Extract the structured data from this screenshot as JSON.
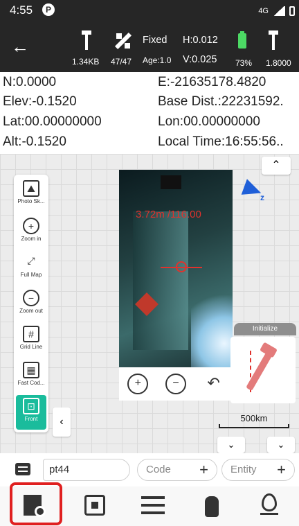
{
  "status_bar": {
    "time": "4:55",
    "carrier_icon_letter": "P",
    "network": "4G"
  },
  "toolbar": {
    "data_size": "1.34KB",
    "satellites": "47/47",
    "solution": "Fixed",
    "age": "Age:1.0",
    "h_precision": "H:0.012",
    "v_precision": "V:0.025",
    "battery_pct": "73%",
    "antenna_height": "1.8000"
  },
  "info": {
    "north": "N:0.0000",
    "east": "E:-21635178.4820",
    "elev": "Elev:-0.1520",
    "base_dist": "Base Dist.:22231592.",
    "lat": "Lat:00.00000000",
    "lon": "Lon:00.00000000",
    "alt": "Alt:-0.1520",
    "local_time": "Local Time:16:55:56.."
  },
  "tools": [
    {
      "label": "Photo Sk...",
      "icon": "photo-sketch-icon",
      "glyph": "⛰"
    },
    {
      "label": "Zoom in",
      "icon": "zoom-in-icon",
      "glyph": "+"
    },
    {
      "label": "Full Map",
      "icon": "full-map-icon",
      "glyph": "⤢"
    },
    {
      "label": "Zoom out",
      "icon": "zoom-out-icon",
      "glyph": "−"
    },
    {
      "label": "Grid Line",
      "icon": "grid-line-icon",
      "glyph": "#"
    },
    {
      "label": "Fast Cod...",
      "icon": "fast-code-icon",
      "glyph": "▦"
    },
    {
      "label": "Front",
      "icon": "front-icon",
      "glyph": "⊡"
    }
  ],
  "camera": {
    "measurement": "3.72m /116.00"
  },
  "initialize": {
    "label": "Initialize"
  },
  "scale": {
    "label": "500km"
  },
  "input_row": {
    "point_name": "pt44",
    "code_placeholder": "Code",
    "entity_placeholder": "Entity"
  },
  "colors": {
    "header_bg": "#262626",
    "accent_green": "#1abc9c",
    "battery_green": "#4cd964",
    "measure_red": "#e0322d",
    "highlight_red": "#e02020",
    "arrow_blue": "#1f5fd8"
  }
}
